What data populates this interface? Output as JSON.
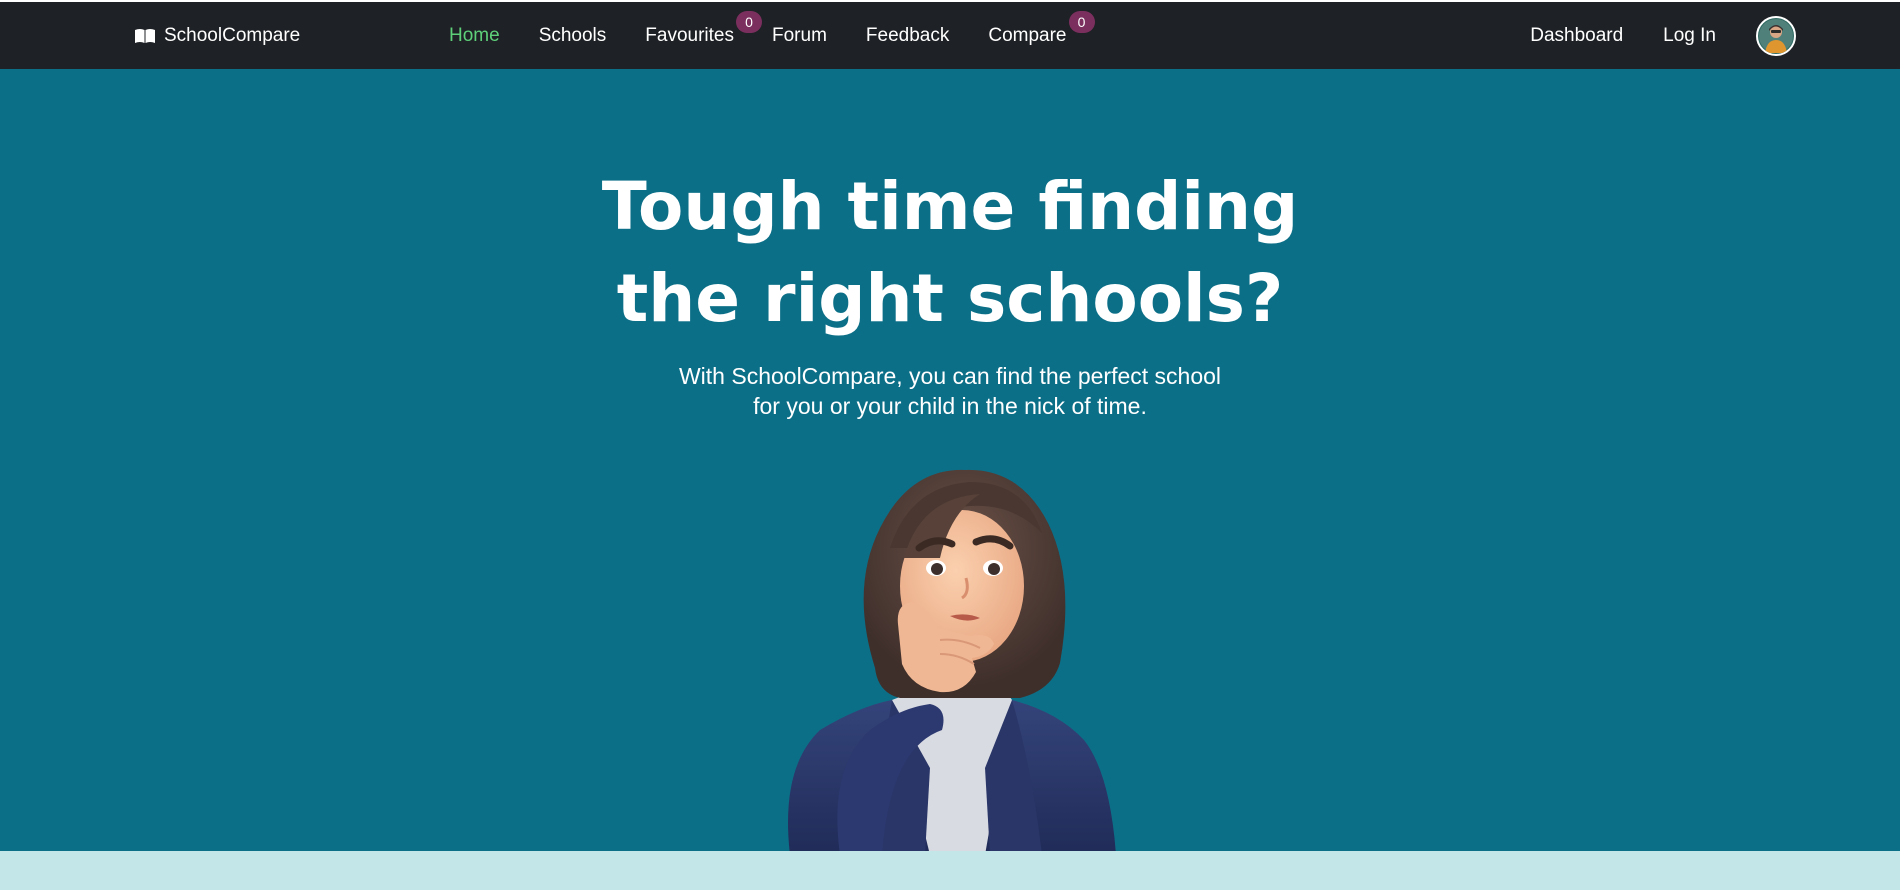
{
  "brand": {
    "name": "SchoolCompare",
    "icon": "book-open-icon"
  },
  "nav": {
    "items": [
      {
        "label": "Home",
        "active": true
      },
      {
        "label": "Schools",
        "active": false
      },
      {
        "label": "Favourites",
        "active": false,
        "badge": "0"
      },
      {
        "label": "Forum",
        "active": false
      },
      {
        "label": "Feedback",
        "active": false
      },
      {
        "label": "Compare",
        "active": false,
        "badge": "0"
      }
    ],
    "right": [
      {
        "label": "Dashboard"
      },
      {
        "label": "Log In"
      }
    ],
    "avatar_icon": "user-avatar-icon"
  },
  "hero": {
    "title_line1": "Tough time finding",
    "title_line2": "the right schools?",
    "subtitle_line1": "With SchoolCompare, you can find the perfect school",
    "subtitle_line2": "for you or your child in the nick of time.",
    "illustration": "thinking-woman-illustration"
  },
  "colors": {
    "navbar_bg": "#1e2125",
    "hero_bg": "#0c6f88",
    "active_link": "#5ed07a",
    "badge_bg": "#7b2f5e",
    "bottom_band": "#c3e7e9"
  }
}
